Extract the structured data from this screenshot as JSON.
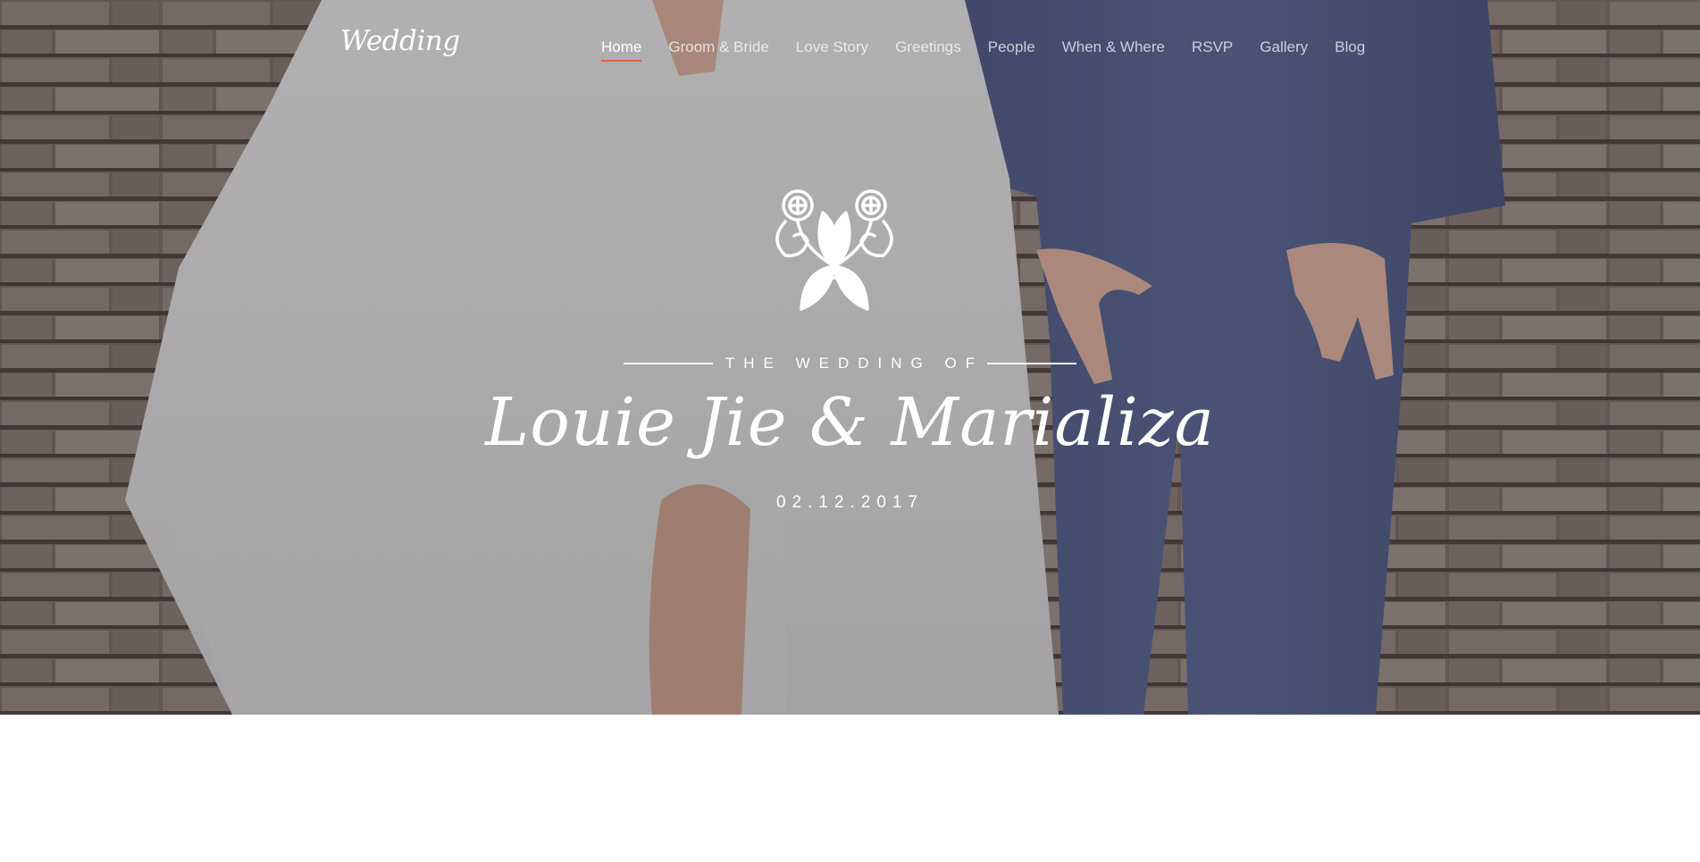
{
  "nav": {
    "logo": "Wedding",
    "items": [
      {
        "label": "Home",
        "active": true
      },
      {
        "label": "Groom & Bride",
        "active": false
      },
      {
        "label": "Love Story",
        "active": false
      },
      {
        "label": "Greetings",
        "active": false
      },
      {
        "label": "People",
        "active": false
      },
      {
        "label": "When & Where",
        "active": false
      },
      {
        "label": "RSVP",
        "active": false
      },
      {
        "label": "Gallery",
        "active": false
      },
      {
        "label": "Blog",
        "active": false
      }
    ]
  },
  "hero": {
    "subtitle": "THE WEDDING OF",
    "names": "Louie Jie & Marializa",
    "date": "02.12.2017",
    "emblem_icon": "floral-emblem-icon",
    "background": "photo-of-bride-and-groom-on-stone-steps"
  },
  "colors": {
    "accent": "#e85c4a",
    "overlay": "rgba(70,70,78,0.32)",
    "text": "#ffffff"
  }
}
